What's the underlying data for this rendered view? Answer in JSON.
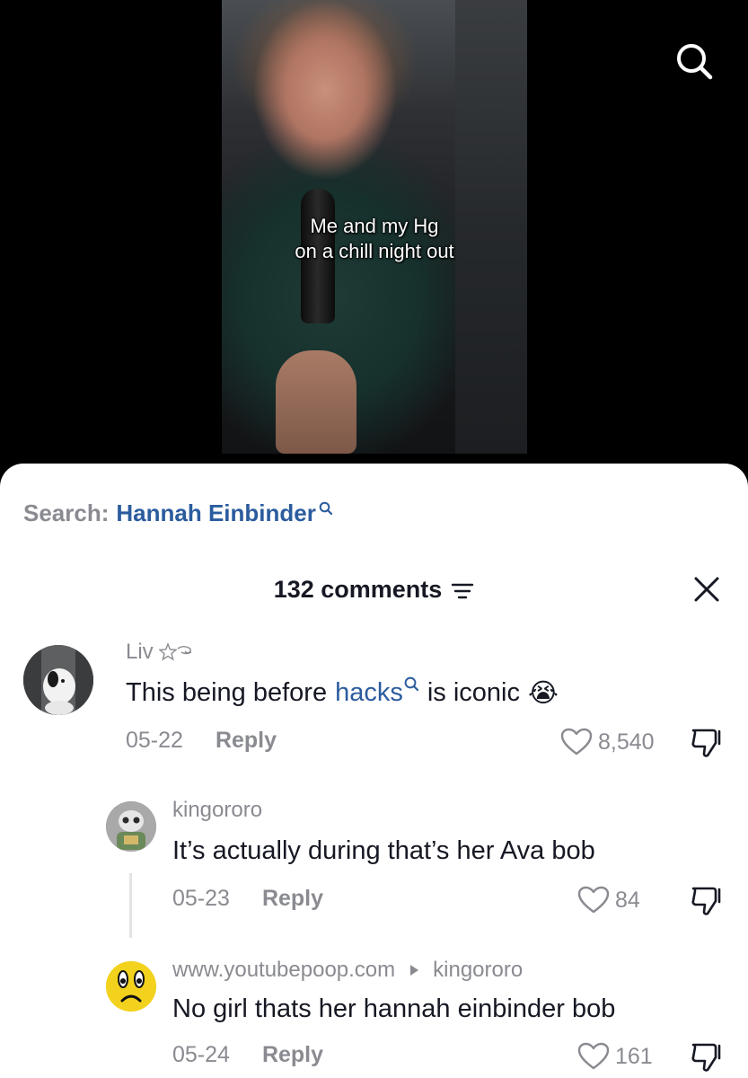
{
  "video": {
    "caption": "Me and my Hg\non a chill night out",
    "search_icon": "search-icon"
  },
  "sheet": {
    "search_label": "Search:",
    "search_query": "Hannah Einbinder",
    "comments_title": "132 comments",
    "filter_icon": "filter-icon",
    "close_icon": "close-icon"
  },
  "comments": [
    {
      "username": "Liv",
      "text_before": "This being before",
      "text_link": "hacks",
      "text_after": "is iconic",
      "emoji": "😭",
      "date": "05-22",
      "reply_label": "Reply",
      "likes": "8,540"
    },
    {
      "username": "kingororo",
      "text": "It’s actually during that’s her Ava bob",
      "date": "05-23",
      "reply_label": "Reply",
      "likes": "84"
    },
    {
      "username": "www.youtubepoop.com",
      "reply_to": "kingororo",
      "text": "No girl thats her hannah einbinder bob",
      "date": "05-24",
      "reply_label": "Reply",
      "likes": "161"
    }
  ],
  "colors": {
    "link": "#2b5c9e",
    "muted": "#8a8b91",
    "text": "#161823"
  }
}
